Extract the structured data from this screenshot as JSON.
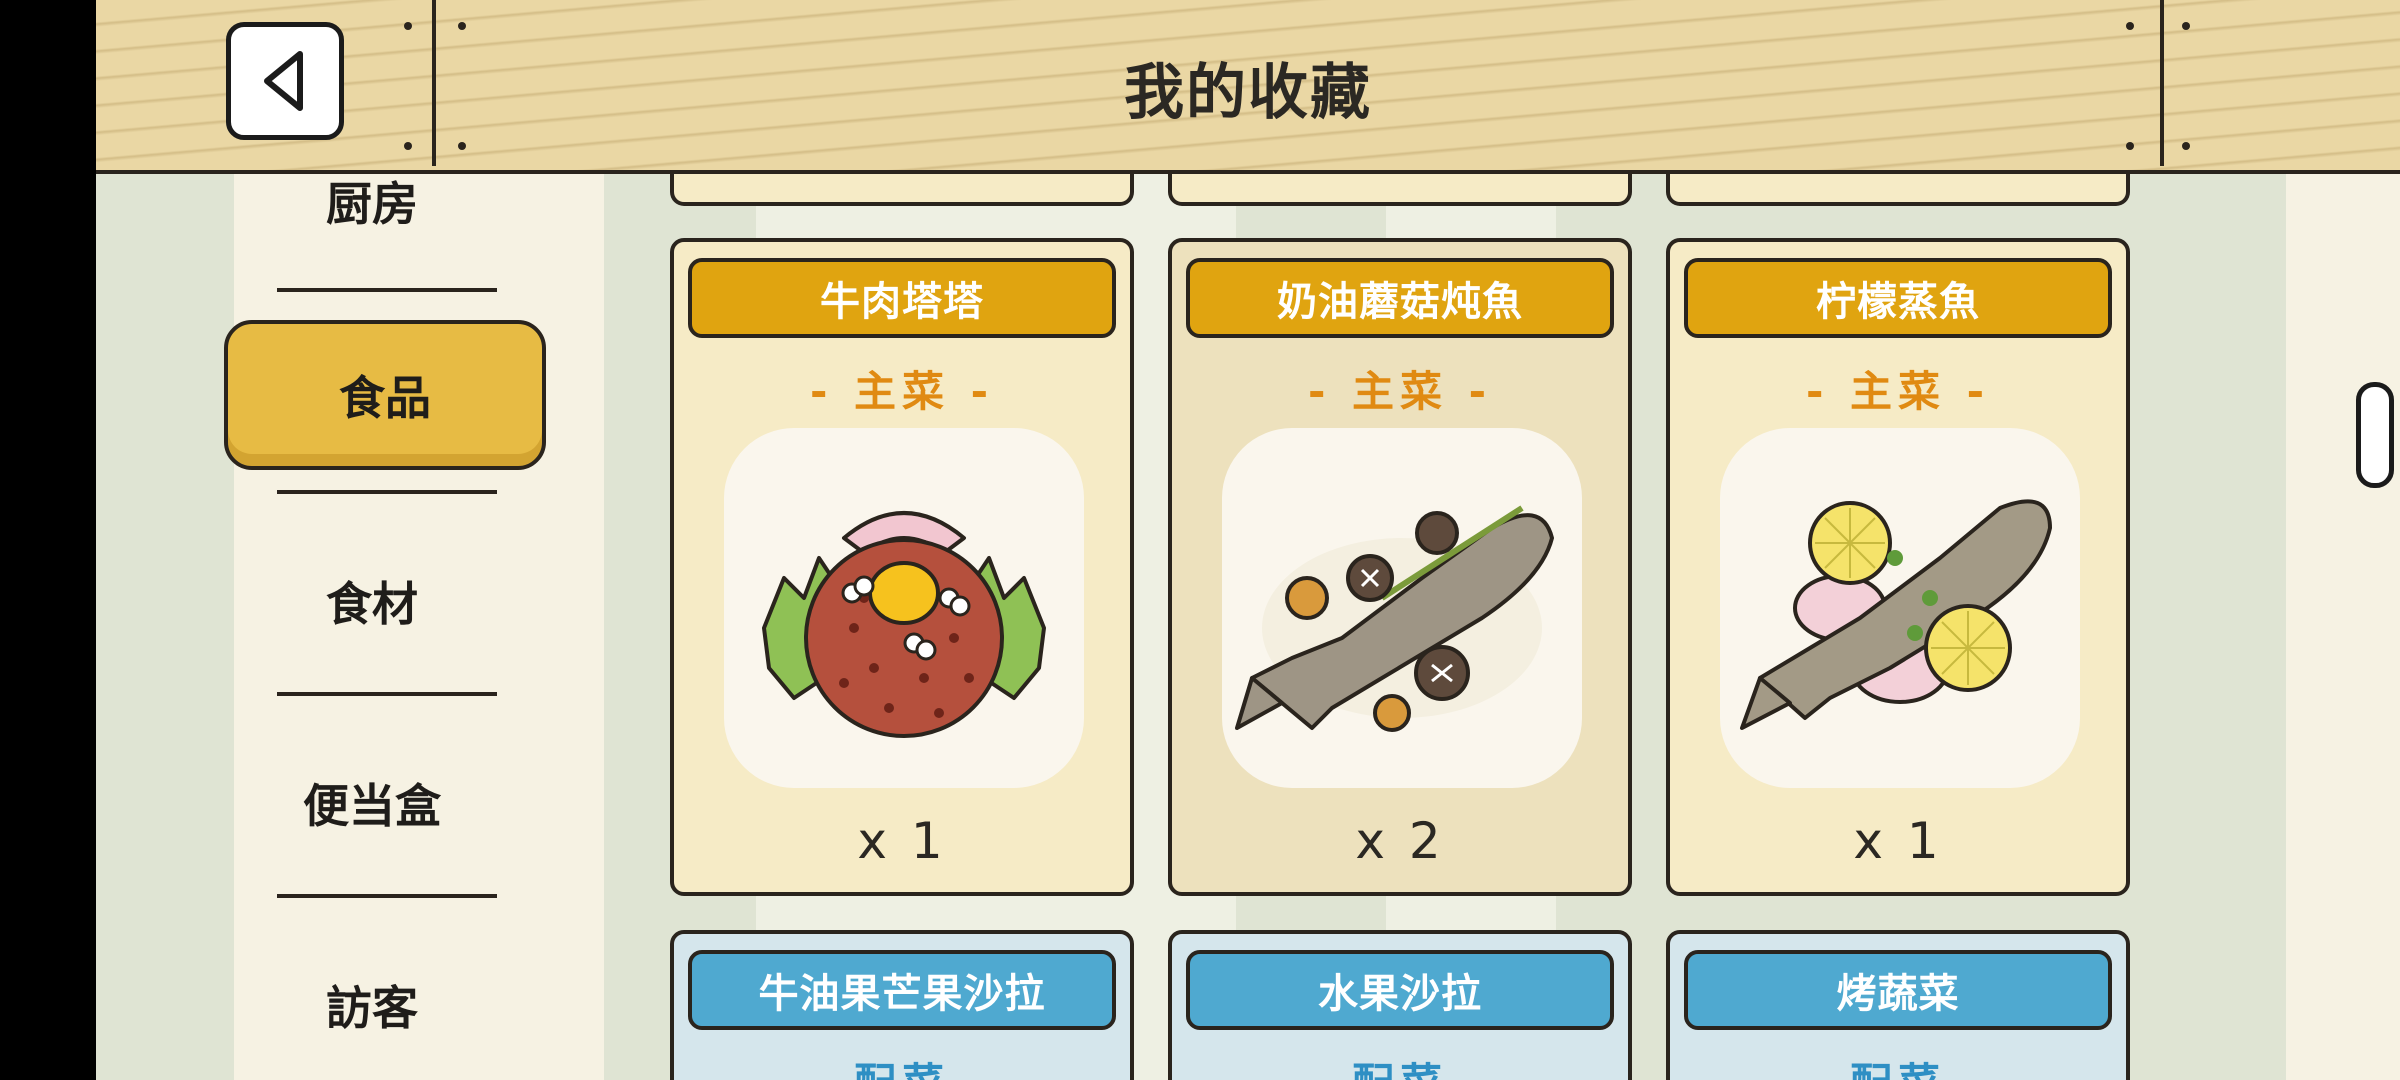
{
  "header": {
    "title": "我的收藏",
    "back_icon": "triangle-left-icon"
  },
  "sidebar": {
    "items": [
      {
        "label": "厨房",
        "selected": false
      },
      {
        "label": "食品",
        "selected": true
      },
      {
        "label": "食材",
        "selected": false
      },
      {
        "label": "便当盒",
        "selected": false
      },
      {
        "label": "訪客",
        "selected": false
      }
    ]
  },
  "cards": [
    {
      "title": "牛肉塔塔",
      "category": "- 主菜 -",
      "quantity": "x 1",
      "icon": "beef-tartare-icon"
    },
    {
      "title": "奶油蘑菇炖魚",
      "category": "- 主菜 -",
      "quantity": "x 2",
      "icon": "mushroom-fish-stew-icon"
    },
    {
      "title": "柠檬蒸魚",
      "category": "- 主菜 -",
      "quantity": "x 1",
      "icon": "steamed-lemon-fish-icon"
    },
    {
      "title": "牛油果芒果沙拉",
      "category": "- 配菜 -",
      "icon": "salad-icon"
    },
    {
      "title": "水果沙拉",
      "category": "- 配菜 -",
      "icon": "salad-icon"
    },
    {
      "title": "烤蔬菜",
      "category": "- 配菜 -",
      "icon": "grilled-vegetables-icon"
    }
  ],
  "colors": {
    "main_dish_title": "#e0a410",
    "main_dish_category": "#e08a12",
    "side_dish_title": "#4fa9d0",
    "side_dish_category": "#2e8fc4",
    "selected_tab": "#e7bb44"
  }
}
